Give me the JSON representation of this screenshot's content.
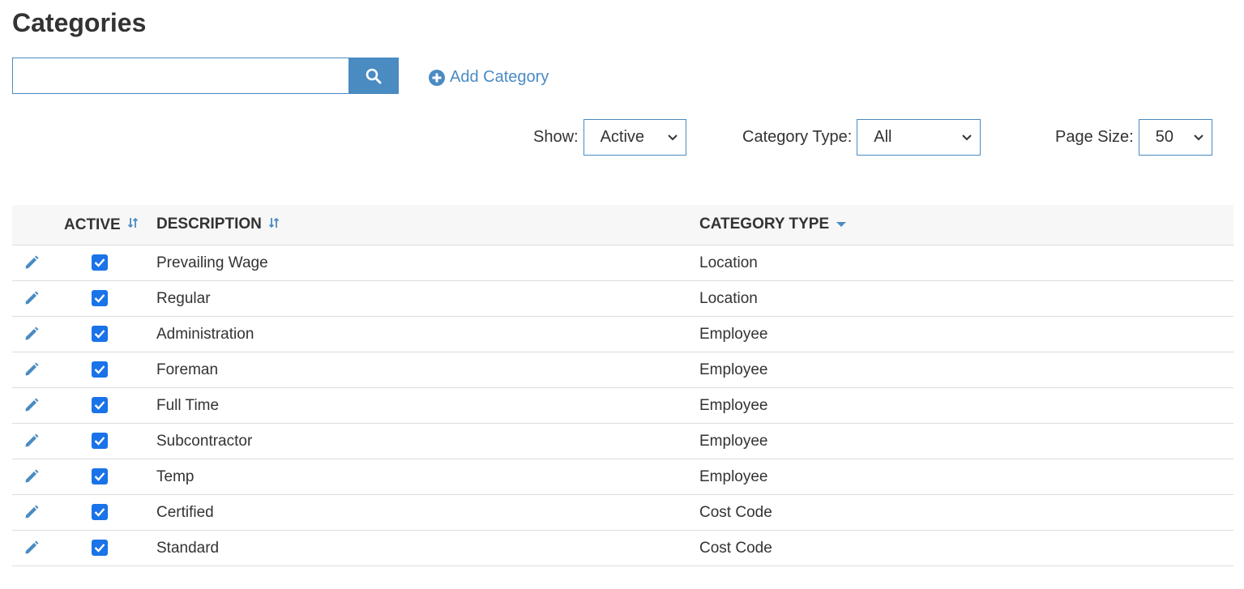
{
  "page": {
    "title": "Categories"
  },
  "search": {
    "value": "",
    "placeholder": ""
  },
  "actions": {
    "add_label": "Add Category"
  },
  "filters": {
    "show": {
      "label": "Show:",
      "selected": "Active"
    },
    "category_type": {
      "label": "Category Type:",
      "selected": "All"
    },
    "page_size": {
      "label": "Page Size:",
      "selected": "50"
    }
  },
  "table": {
    "headers": {
      "active": "ACTIVE",
      "description": "DESCRIPTION",
      "category_type": "CATEGORY TYPE"
    },
    "rows": [
      {
        "active": true,
        "description": "Prevailing Wage",
        "category_type": "Location"
      },
      {
        "active": true,
        "description": "Regular",
        "category_type": "Location"
      },
      {
        "active": true,
        "description": "Administration",
        "category_type": "Employee"
      },
      {
        "active": true,
        "description": "Foreman",
        "category_type": "Employee"
      },
      {
        "active": true,
        "description": "Full Time",
        "category_type": "Employee"
      },
      {
        "active": true,
        "description": "Subcontractor",
        "category_type": "Employee"
      },
      {
        "active": true,
        "description": "Temp",
        "category_type": "Employee"
      },
      {
        "active": true,
        "description": "Certified",
        "category_type": "Cost Code"
      },
      {
        "active": true,
        "description": "Standard",
        "category_type": "Cost Code"
      }
    ]
  },
  "colors": {
    "accent": "#4a8bc2",
    "checkbox": "#1a73e8",
    "header_bg": "#f7f7f7",
    "text": "#333333"
  },
  "icons": {
    "search": "search-icon",
    "add": "plus-circle-icon",
    "edit": "pencil-icon",
    "sort": "sort-icon",
    "sort_active": "caret-down-icon",
    "dropdown": "chevron-down-icon",
    "check": "checkmark-icon"
  }
}
